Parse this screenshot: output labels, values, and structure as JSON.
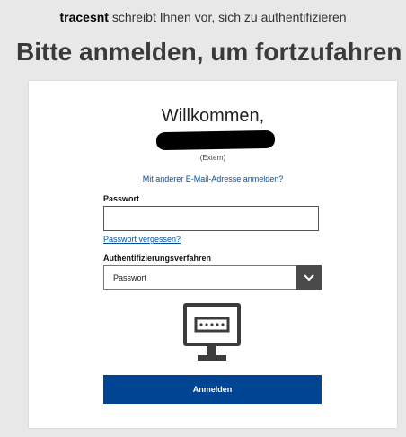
{
  "header": {
    "app_name": "tracesnt",
    "subtitle_suffix": " schreibt Ihnen vor, sich zu authentifizieren",
    "title": "Bitte anmelden, um fortzufahren"
  },
  "card": {
    "welcome": "Willkommen,",
    "account_type": "(Extern)",
    "other_email_link": "Mit anderer E-Mail-Adresse anmelden?",
    "password_label": "Passwort",
    "password_value": "",
    "forgot_password_link": "Passwort vergessen?",
    "auth_method_label": "Authentifizierungsverfahren",
    "auth_method_value": "Passwort",
    "login_button": "Anmelden"
  },
  "icons": {
    "dropdown": "chevron-down-icon",
    "method": "monitor-password-icon"
  },
  "colors": {
    "background": "#e8e8e8",
    "card": "#ffffff",
    "link": "#0050a0",
    "primary_button": "#004494",
    "select_button": "#4a4a4a"
  }
}
